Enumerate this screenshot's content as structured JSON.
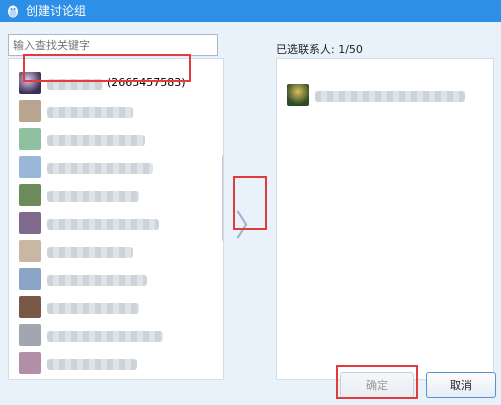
{
  "window": {
    "title": "创建讨论组"
  },
  "search": {
    "placeholder": "输入查找关键字"
  },
  "contacts": {
    "first": {
      "id_text": "(2665457583)"
    }
  },
  "selected": {
    "label": "已选联系人: 1/50"
  },
  "buttons": {
    "ok": "确定",
    "cancel": "取消"
  },
  "colors": {
    "titlebar": "#2d8fe6",
    "highlight": "#e23b3b",
    "panel_bg": "#e9f1fb"
  },
  "icons": {
    "title_logo": "penguin-icon",
    "transfer": "chevron-right-icon"
  }
}
